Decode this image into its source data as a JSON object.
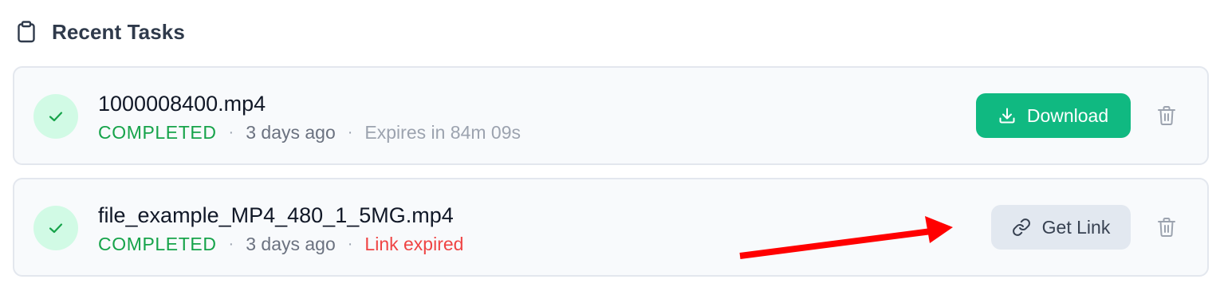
{
  "header": {
    "title": "Recent Tasks",
    "icon": "clipboard-icon"
  },
  "tasks": [
    {
      "file_name": "1000008400.mp4",
      "status": "COMPLETED",
      "age": "3 days ago",
      "expiry_text": "Expires in 84m 09s",
      "action_label": "Download",
      "action_icon": "download-icon",
      "status_icon": "check-icon"
    },
    {
      "file_name": "file_example_MP4_480_1_5MG.mp4",
      "status": "COMPLETED",
      "age": "3 days ago",
      "expiry_text": "Link expired",
      "action_label": "Get Link",
      "action_icon": "link-icon",
      "status_icon": "check-icon"
    }
  ],
  "separator": "·",
  "colors": {
    "success": "#16a34a",
    "download_button": "#10b981",
    "get_link_button": "#e2e8f0",
    "expired": "#ef4444",
    "annotation_arrow": "#ff0000"
  }
}
